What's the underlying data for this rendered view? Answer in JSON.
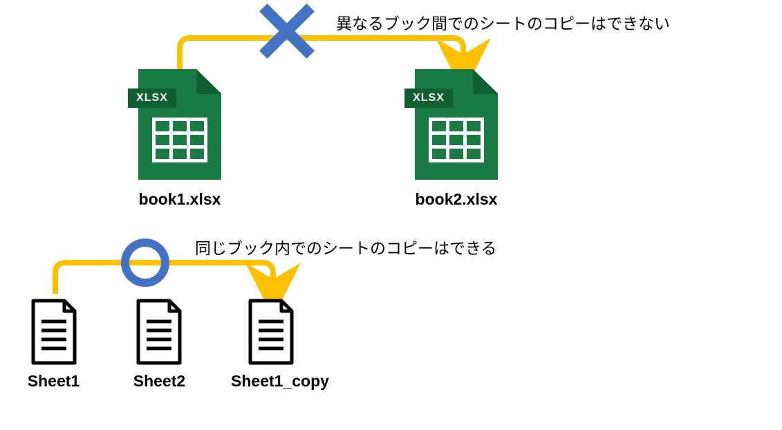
{
  "caption_top": "異なるブック間でのシートのコピーはできない",
  "caption_bottom": "同じブック内でのシートのコピーはできる",
  "book1_label": "book1.xlsx",
  "book2_label": "book2.xlsx",
  "sheet1_label": "Sheet1",
  "sheet2_label": "Sheet2",
  "sheet_copy_label": "Sheet1_copy",
  "xlsx_badge": "XLSX",
  "colors": {
    "arrow": "#ffc000",
    "mark": "#4472c4",
    "xlsx_body": "#1a7a43",
    "xlsx_dark": "#0f5f30"
  }
}
